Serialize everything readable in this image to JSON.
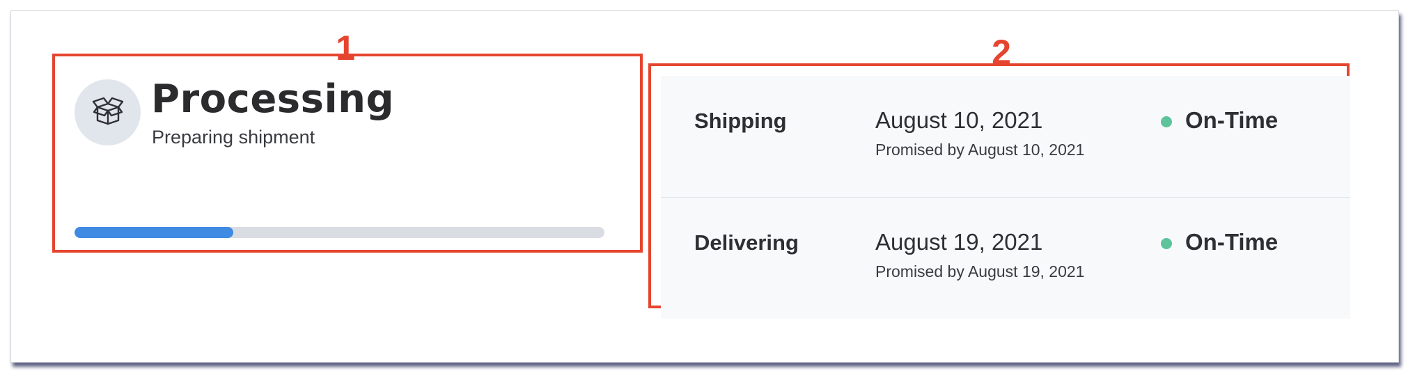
{
  "callouts": [
    "1",
    "2"
  ],
  "status": {
    "title": "Processing",
    "subtitle": "Preparing shipment",
    "icon": "box-open-icon",
    "progress_fraction": 0.3
  },
  "timeline": [
    {
      "label": "Shipping",
      "date": "August 10, 2021",
      "promise": "Promised by August 10, 2021",
      "status": "On-Time"
    },
    {
      "label": "Delivering",
      "date": "August 19, 2021",
      "promise": "Promised by August 19, 2021",
      "status": "On-Time"
    }
  ],
  "colors": {
    "callout": "#e5452f",
    "progress": "#3f8ae3",
    "progress_track": "#d9dce2",
    "on_time": "#5cc39a",
    "panel_bg": "#f8f9fb",
    "icon_circle": "#e1e5ec"
  }
}
